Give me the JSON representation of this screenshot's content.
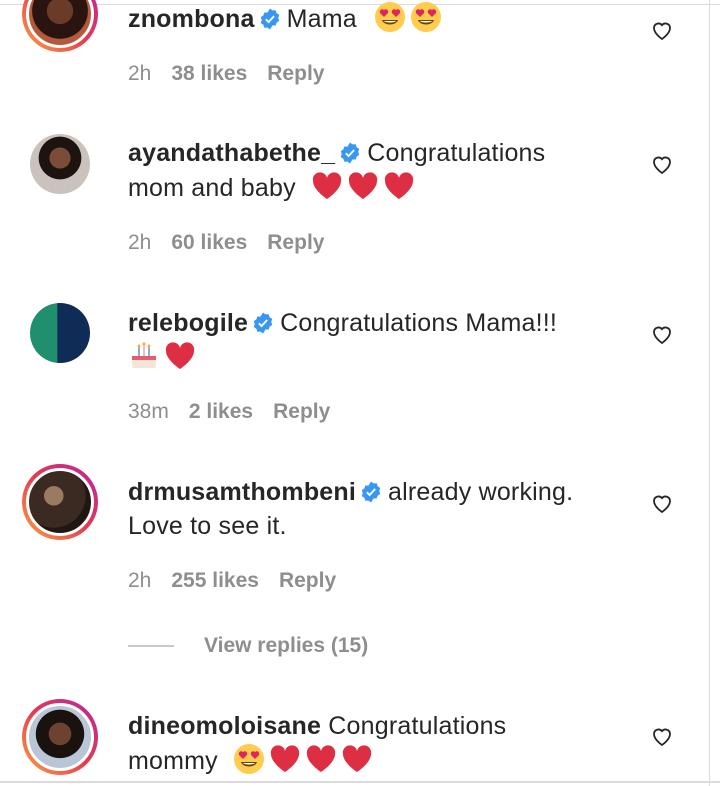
{
  "comments": [
    {
      "username": "znombona",
      "verified": true,
      "text": "Mama",
      "emojis": [
        "heart-eyes",
        "heart-eyes"
      ],
      "continuation": "",
      "time": "2h",
      "likes": "38 likes",
      "reply": "Reply"
    },
    {
      "username": "ayandathabethe_",
      "verified": true,
      "text": "Congratulations",
      "continuation": "mom and baby",
      "emojis": [
        "red-heart",
        "red-heart",
        "red-heart"
      ],
      "time": "2h",
      "likes": "60 likes",
      "reply": "Reply"
    },
    {
      "username": "relebogile",
      "verified": true,
      "text": "Congratulations Mama!!!",
      "continuation": "",
      "emojis": [
        "birthday-cake",
        "red-heart"
      ],
      "time": "38m",
      "likes": "2 likes",
      "reply": "Reply"
    },
    {
      "username": "drmusamthombeni",
      "verified": true,
      "text": "already working.",
      "continuation": "Love to see it.",
      "emojis": [],
      "time": "2h",
      "likes": "255 likes",
      "reply": "Reply"
    },
    {
      "username": "dineomoloisane",
      "verified": false,
      "text": "Congratulations",
      "continuation": "mommy",
      "emojis": [
        "heart-eyes",
        "red-heart",
        "red-heart",
        "red-heart"
      ]
    }
  ],
  "view_replies": "View replies (15)",
  "colors": {
    "text": "#262626",
    "meta": "#8e8e8e",
    "verified": "#3897f0",
    "heart": "#ed4956"
  }
}
